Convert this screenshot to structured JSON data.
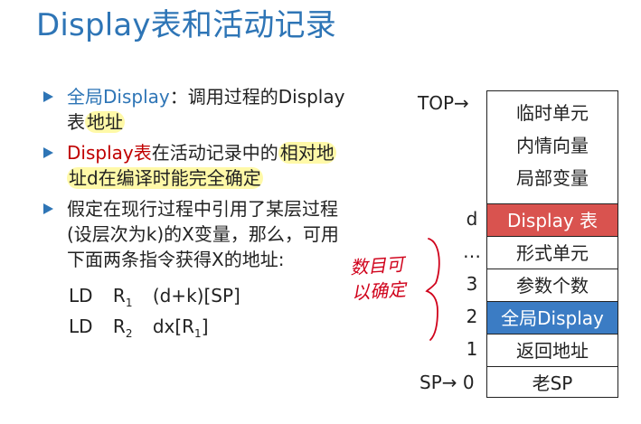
{
  "title": "Display表和活动记录",
  "bullets": [
    {
      "lead": "全局Display",
      "rest": "：调用过程的Display",
      "line2_plain": "表",
      "line2_hl": "地址"
    },
    {
      "lead": "Display表",
      "mid": "在活动记录中的",
      "hl1": "相对地",
      "hl2": "址d在编译时能完全确定"
    },
    {
      "line1": "假定在现行过程中引用了某层过程",
      "line2": "(设层次为k)的X变量，那么，可用",
      "line3": "下面两条指令获得X的地址:"
    }
  ],
  "code": [
    {
      "op": "LD",
      "reg": "R",
      "sub": "1",
      "arg": "(d+k)[SP]"
    },
    {
      "op": "LD",
      "reg": "R",
      "sub": "2",
      "arg": "dx[R",
      "arg_sub": "1",
      "arg_end": "]"
    }
  ],
  "stack": {
    "top_label": "TOP→",
    "sp_label": "SP→ 0",
    "upper": [
      "临时单元",
      "内情向量",
      "局部变量"
    ],
    "cells": [
      {
        "label": "Display 表",
        "index": "d"
      },
      {
        "label": "形式单元",
        "index": "…"
      },
      {
        "label": "参数个数",
        "index": "3"
      },
      {
        "label": "全局Display",
        "index": "2"
      },
      {
        "label": "返回地址",
        "index": "1"
      },
      {
        "label": "老SP",
        "index": ""
      }
    ]
  },
  "annotation": {
    "line1": "数目可",
    "line2": "以确定"
  },
  "colors": {
    "title": "#2e75b6",
    "display_cell": "#d9534f",
    "global_cell": "#3b7cc4",
    "highlight": "#fff9a8",
    "handwriting": "#d0021b"
  }
}
